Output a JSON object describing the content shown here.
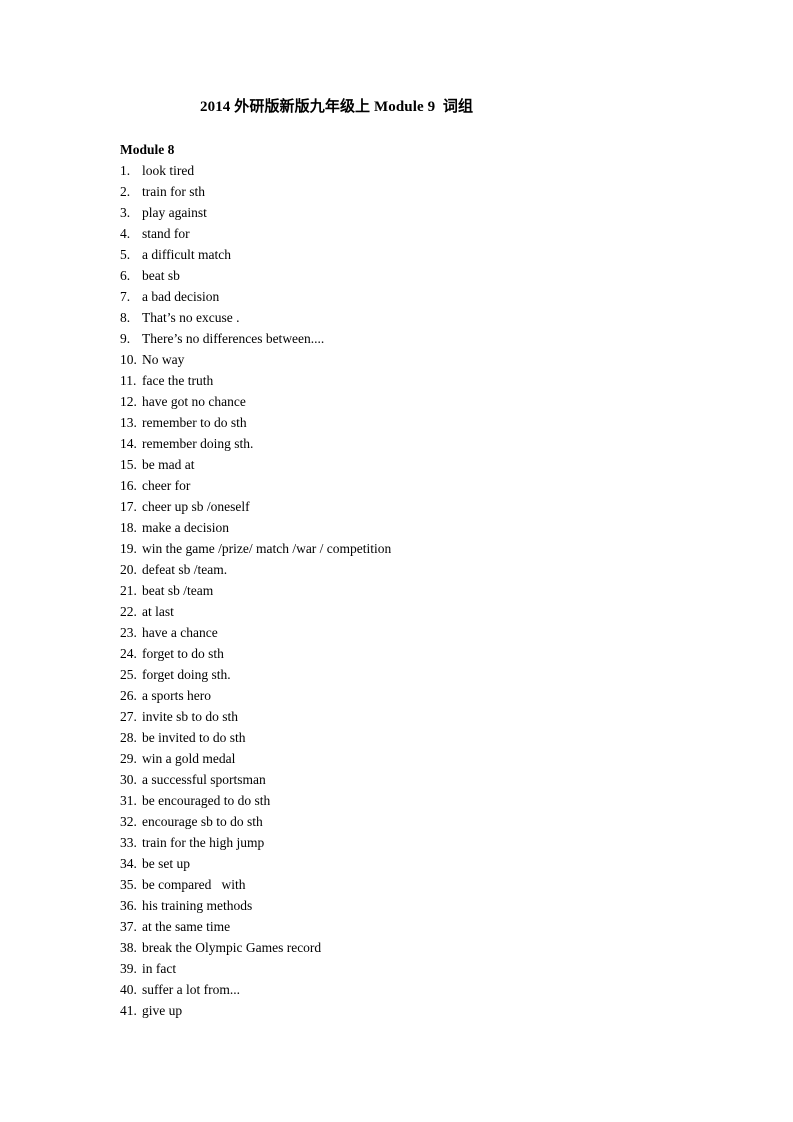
{
  "document": {
    "title": "2014 外研版新版九年级上 Module 9  词组",
    "section_heading": "Module 8",
    "page_background": "#ffffff",
    "text_color": "#000000"
  },
  "phrases": [
    {
      "num": "1.",
      "text": "look tired"
    },
    {
      "num": "2.",
      "text": "train for sth"
    },
    {
      "num": "3.",
      "text": "play against"
    },
    {
      "num": "4.",
      "text": "stand for"
    },
    {
      "num": "5.",
      "text": "a difficult match"
    },
    {
      "num": "6.",
      "text": "beat sb"
    },
    {
      "num": "7.",
      "text": "a bad decision"
    },
    {
      "num": "8.",
      "text": "That’s no excuse ."
    },
    {
      "num": "9.",
      "text": "There’s no differences between...."
    },
    {
      "num": "10.",
      "text": "No way"
    },
    {
      "num": "11.",
      "text": "face the truth"
    },
    {
      "num": "12.",
      "text": "have got no chance"
    },
    {
      "num": "13.",
      "text": "remember to do sth"
    },
    {
      "num": "14.",
      "text": "remember doing sth."
    },
    {
      "num": "15.",
      "text": "be mad at"
    },
    {
      "num": "16.",
      "text": "cheer for"
    },
    {
      "num": "17.",
      "text": "cheer up sb /oneself"
    },
    {
      "num": "18.",
      "text": "make a decision"
    },
    {
      "num": "19.",
      "text": "win the game /prize/ match /war / competition"
    },
    {
      "num": "20.",
      "text": "defeat sb /team."
    },
    {
      "num": "21.",
      "text": "beat sb /team"
    },
    {
      "num": "22.",
      "text": "at last"
    },
    {
      "num": "23.",
      "text": "have a chance"
    },
    {
      "num": "24.",
      "text": "forget to do sth"
    },
    {
      "num": "25.",
      "text": "forget doing sth."
    },
    {
      "num": "26.",
      "text": "a sports hero"
    },
    {
      "num": "27.",
      "text": "invite sb to do sth"
    },
    {
      "num": "28.",
      "text": "be invited to do sth"
    },
    {
      "num": "29.",
      "text": "win a gold medal"
    },
    {
      "num": "30.",
      "text": "a successful sportsman"
    },
    {
      "num": "31.",
      "text": "be encouraged to do sth"
    },
    {
      "num": "32.",
      "text": "encourage sb to do sth"
    },
    {
      "num": "33.",
      "text": "train for the high jump"
    },
    {
      "num": "34.",
      "text": "be set up"
    },
    {
      "num": "35.",
      "text": "be compared   with"
    },
    {
      "num": "36.",
      "text": "his training methods"
    },
    {
      "num": "37.",
      "text": "at the same time"
    },
    {
      "num": "38.",
      "text": "break the Olympic Games record"
    },
    {
      "num": "39.",
      "text": "in fact"
    },
    {
      "num": "40.",
      "text": "suffer a lot from..."
    },
    {
      "num": "41.",
      "text": "give up"
    }
  ]
}
